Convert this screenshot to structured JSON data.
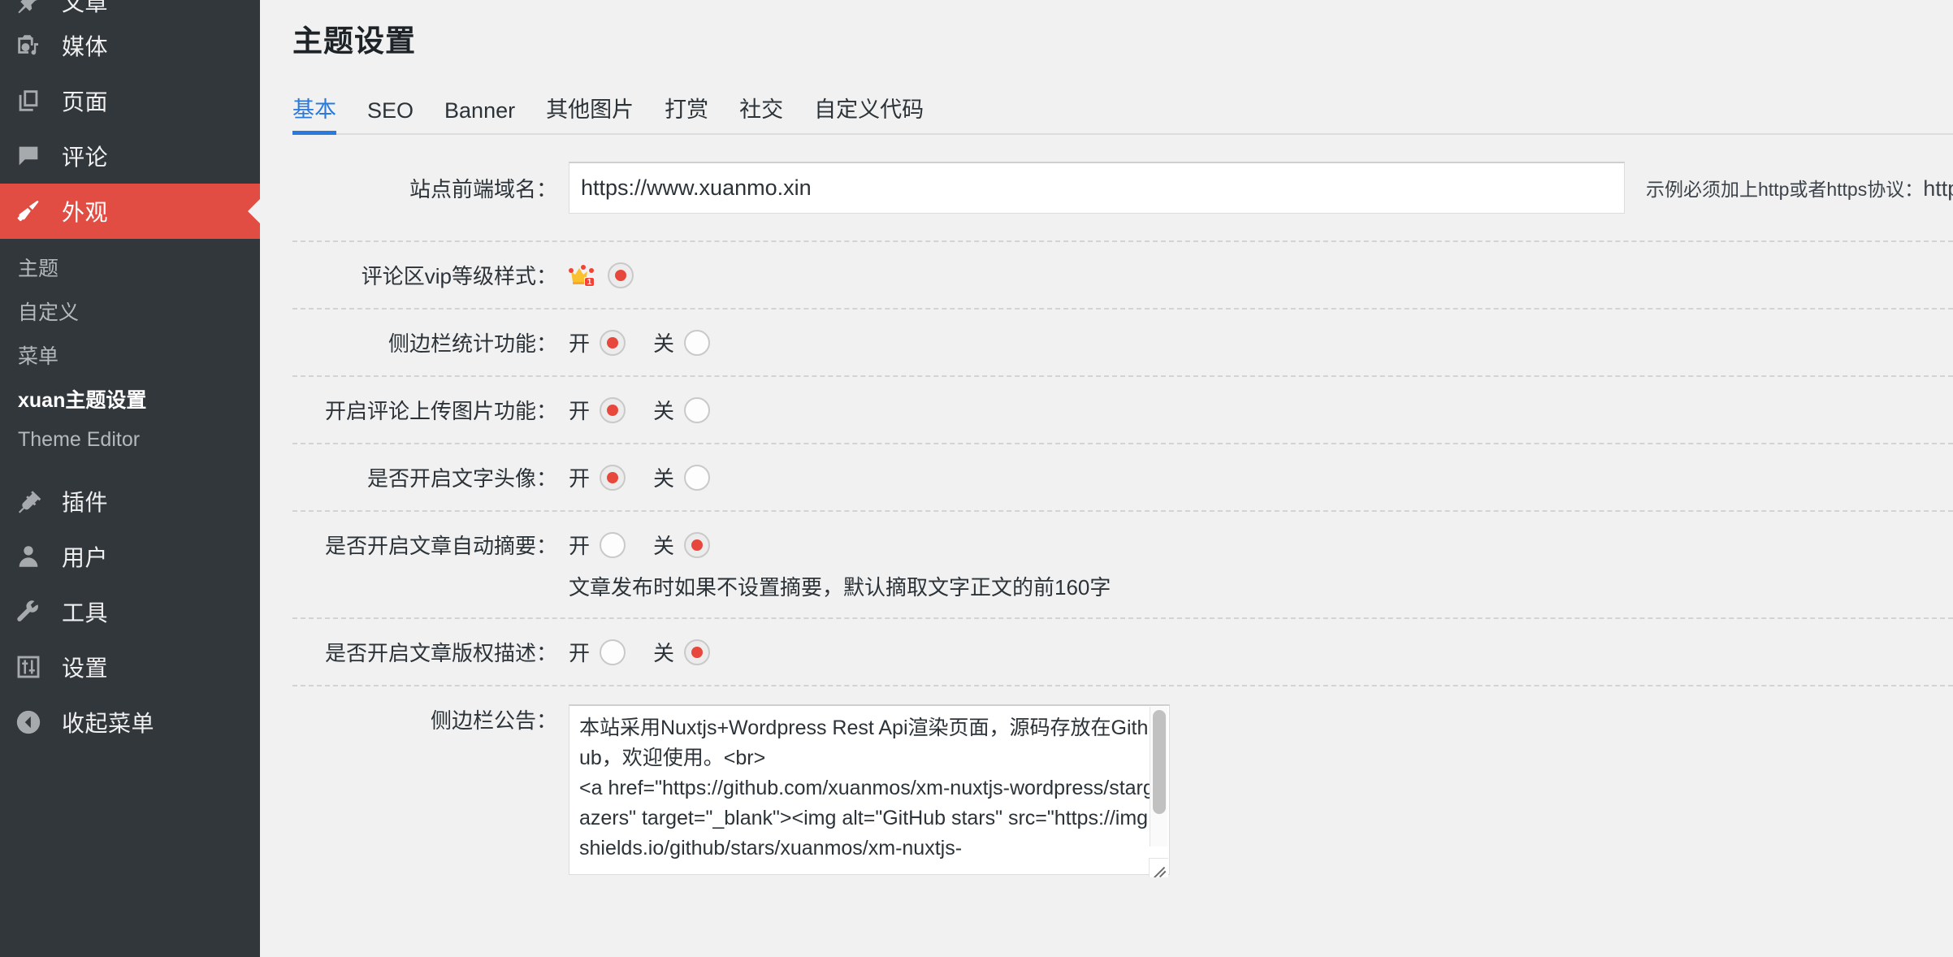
{
  "sidebar": {
    "items": [
      {
        "label": "文章",
        "icon": "pin-icon",
        "state": "cut"
      },
      {
        "label": "媒体",
        "icon": "media-icon",
        "state": "normal"
      },
      {
        "label": "页面",
        "icon": "page-icon",
        "state": "normal"
      },
      {
        "label": "评论",
        "icon": "comment-icon",
        "state": "normal"
      },
      {
        "label": "外观",
        "icon": "appearance-brush-icon",
        "state": "active"
      }
    ],
    "submenu": [
      {
        "label": "主题",
        "current": false
      },
      {
        "label": "自定义",
        "current": false
      },
      {
        "label": "菜单",
        "current": false
      },
      {
        "label": "xuan主题设置",
        "current": true
      },
      {
        "label": "Theme Editor",
        "current": false
      }
    ],
    "items_bottom": [
      {
        "label": "插件",
        "icon": "plugin-icon"
      },
      {
        "label": "用户",
        "icon": "user-icon"
      },
      {
        "label": "工具",
        "icon": "tools-wrench-icon"
      },
      {
        "label": "设置",
        "icon": "settings-sliders-icon"
      },
      {
        "label": "收起菜单",
        "icon": "collapse-arrow-icon"
      }
    ],
    "active_color": "#e14d43",
    "background_color": "#32373c"
  },
  "page": {
    "title": "主题设置",
    "accent_color": "#2a7ade"
  },
  "tabs": [
    {
      "label": "基本",
      "active": true
    },
    {
      "label": "SEO",
      "active": false
    },
    {
      "label": "Banner",
      "active": false
    },
    {
      "label": "其他图片",
      "active": false
    },
    {
      "label": "打赏",
      "active": false
    },
    {
      "label": "社交",
      "active": false
    },
    {
      "label": "自定义代码",
      "active": false
    }
  ],
  "form": {
    "domain": {
      "label": "站点前端域名：",
      "value": "https://www.xuanmo.xin",
      "hint_text": "示例必须加上http或者https协议：",
      "hint_url": "https://www.xuanmo.xin"
    },
    "vip_style": {
      "label": "评论区vip等级样式：",
      "emoji_name": "crown-level-1-icon",
      "selected": true
    },
    "sidebar_stats": {
      "label": "侧边栏统计功能：",
      "on_label": "开",
      "off_label": "关",
      "value": "on"
    },
    "comment_upload": {
      "label": "开启评论上传图片功能：",
      "on_label": "开",
      "off_label": "关",
      "value": "on"
    },
    "text_avatar": {
      "label": "是否开启文字头像：",
      "on_label": "开",
      "off_label": "关",
      "value": "on"
    },
    "auto_excerpt": {
      "label": "是否开启文章自动摘要：",
      "on_label": "开",
      "off_label": "关",
      "value": "off",
      "desc": "文章发布时如果不设置摘要，默认摘取文字正文的前160字"
    },
    "copyright_desc": {
      "label": "是否开启文章版权描述：",
      "on_label": "开",
      "off_label": "关",
      "value": "off"
    },
    "sidebar_notice": {
      "label": "侧边栏公告：",
      "value": "本站采用Nuxtjs+Wordpress Rest Api渲染页面，源码存放在Github，欢迎使用。<br>\n<a href=\"https://github.com/xuanmos/xm-nuxtjs-wordpress/stargazers\" target=\"_blank\"><img alt=\"GitHub stars\" src=\"https://img.shields.io/github/stars/xuanmos/xm-nuxtjs-"
    }
  }
}
